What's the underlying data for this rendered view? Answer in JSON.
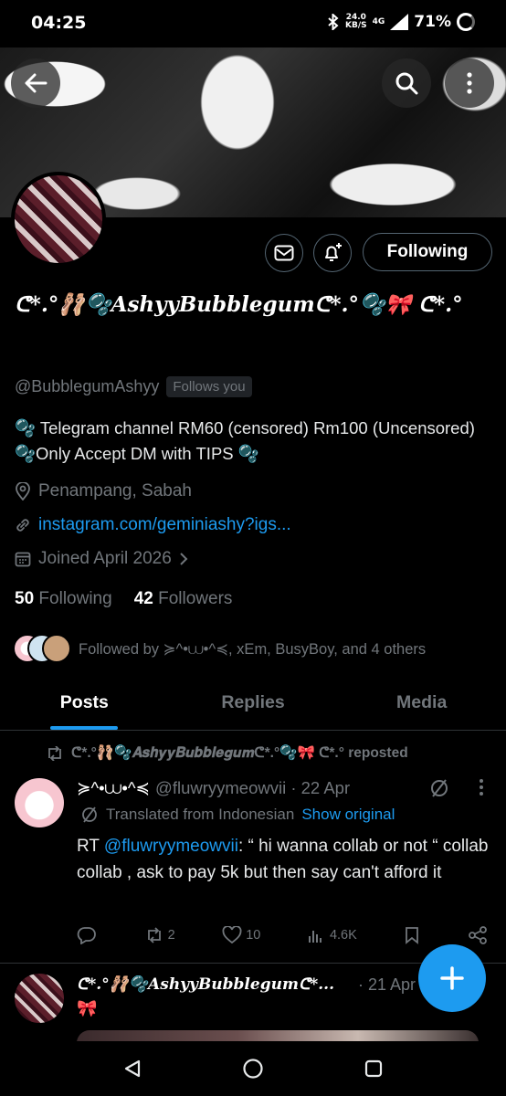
{
  "status_bar": {
    "time": "04:25",
    "speed_value": "24.0",
    "speed_unit": "KB/S",
    "network": "4G",
    "battery": "71%"
  },
  "profile": {
    "display_name": "ᕦ*.°🩰🫧𝑨𝒔𝒉𝒚𝒚𝑩𝒖𝒃𝒃𝒍𝒆𝒈𝒖𝒎ᕦ*.°🫧🎀 ᕦ*.°",
    "handle": "@BubblegumAshyy",
    "follows_you": "Follows you",
    "bio": "🫧 Telegram channel RM60 (censored) Rm100 (Uncensored) 🫧Only Accept DM with TIPS 🫧",
    "location": "Penampang, Sabah",
    "link": "instagram.com/geminiashy?igs...",
    "joined": "Joined April 2026",
    "following_count": "50",
    "following_label": "Following",
    "followers_count": "42",
    "followers_label": "Followers",
    "followed_by": "Followed by ≽^•⩊•^≼, xEm, BusyBoy, and 4 others",
    "following_button": "Following"
  },
  "tabs": [
    {
      "label": "Posts",
      "active": true
    },
    {
      "label": "Replies",
      "active": false
    },
    {
      "label": "Media",
      "active": false
    }
  ],
  "posts": [
    {
      "repost_text": "ᕦ*.°🩰🫧𝑨𝒔𝒉𝒚𝒚𝑩𝒖𝒃𝒃𝒍𝒆𝒈𝒖𝒎ᕦ*.°🫧🎀 ᕦ*.° reposted",
      "name": "≽^•⩊•^≼",
      "handle_date": "@fluwryymeowvii · 22 Apr",
      "translated": "Translated from Indonesian",
      "show_original": "Show original",
      "text_prefix": "RT ",
      "mention": "@fluwryymeowvii",
      "text_body": ": “ hi wanna collab or not “ collab collab , ask to pay 5k but then say can't afford it",
      "retweets": "2",
      "likes": "10",
      "views": "4.6K"
    },
    {
      "name": "ᕦ*.°🩰🫧𝑨𝒔𝒉𝒚𝒚𝑩𝒖𝒃𝒃𝒍𝒆𝒈𝒖𝒎ᕦ*...",
      "date": "· 21 Apr",
      "emoji": "🎀"
    }
  ],
  "colors": {
    "accent": "#1d9bf0",
    "muted": "#71767b",
    "background": "#000000"
  },
  "icons": [
    "back-arrow-icon",
    "search-icon",
    "more-vertical-icon",
    "mail-icon",
    "bell-plus-icon",
    "location-pin-icon",
    "link-icon",
    "calendar-icon",
    "chevron-right-icon",
    "repost-icon",
    "reply-icon",
    "like-icon",
    "views-icon",
    "bookmark-icon",
    "share-icon",
    "plus-icon",
    "nav-back-icon",
    "nav-home-icon",
    "nav-recents-icon"
  ]
}
